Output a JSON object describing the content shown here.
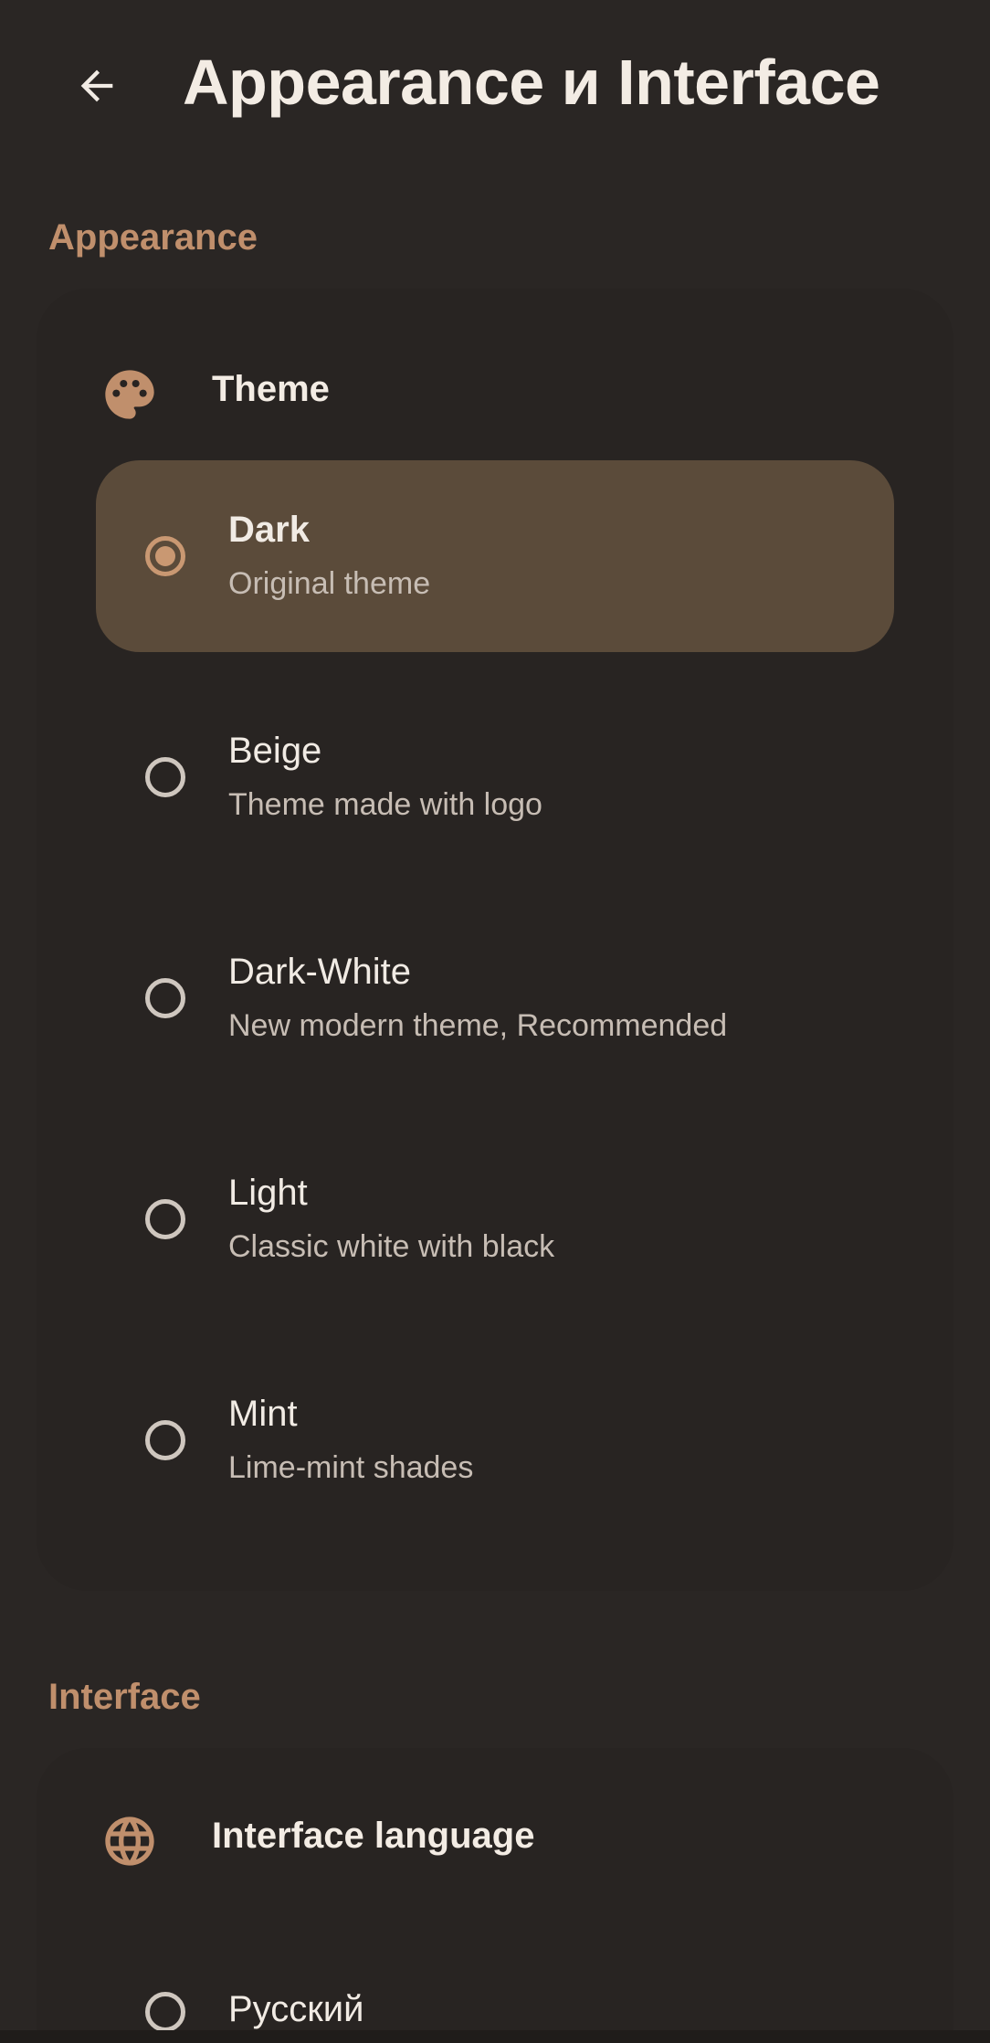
{
  "header": {
    "back_icon": "arrow-left-icon",
    "title": "Appearance и Interface"
  },
  "appearance": {
    "section_label": "Appearance",
    "card_icon": "palette-icon",
    "card_title": "Theme",
    "accent_color": "#c08f6c",
    "selected_bg": "#5b4b3a",
    "options": [
      {
        "title": "Dark",
        "subtitle": "Original theme",
        "selected": true
      },
      {
        "title": "Beige",
        "subtitle": "Theme made with logo",
        "selected": false
      },
      {
        "title": "Dark-White",
        "subtitle": "New modern theme, Recommended",
        "selected": false
      },
      {
        "title": "Light",
        "subtitle": "Classic white with black",
        "selected": false
      },
      {
        "title": "Mint",
        "subtitle": "Lime-mint shades",
        "selected": false
      }
    ]
  },
  "interface": {
    "section_label": "Interface",
    "card_icon": "globe-icon",
    "card_title": "Interface language",
    "options": [
      {
        "title": "Русский",
        "selected": false
      }
    ]
  }
}
